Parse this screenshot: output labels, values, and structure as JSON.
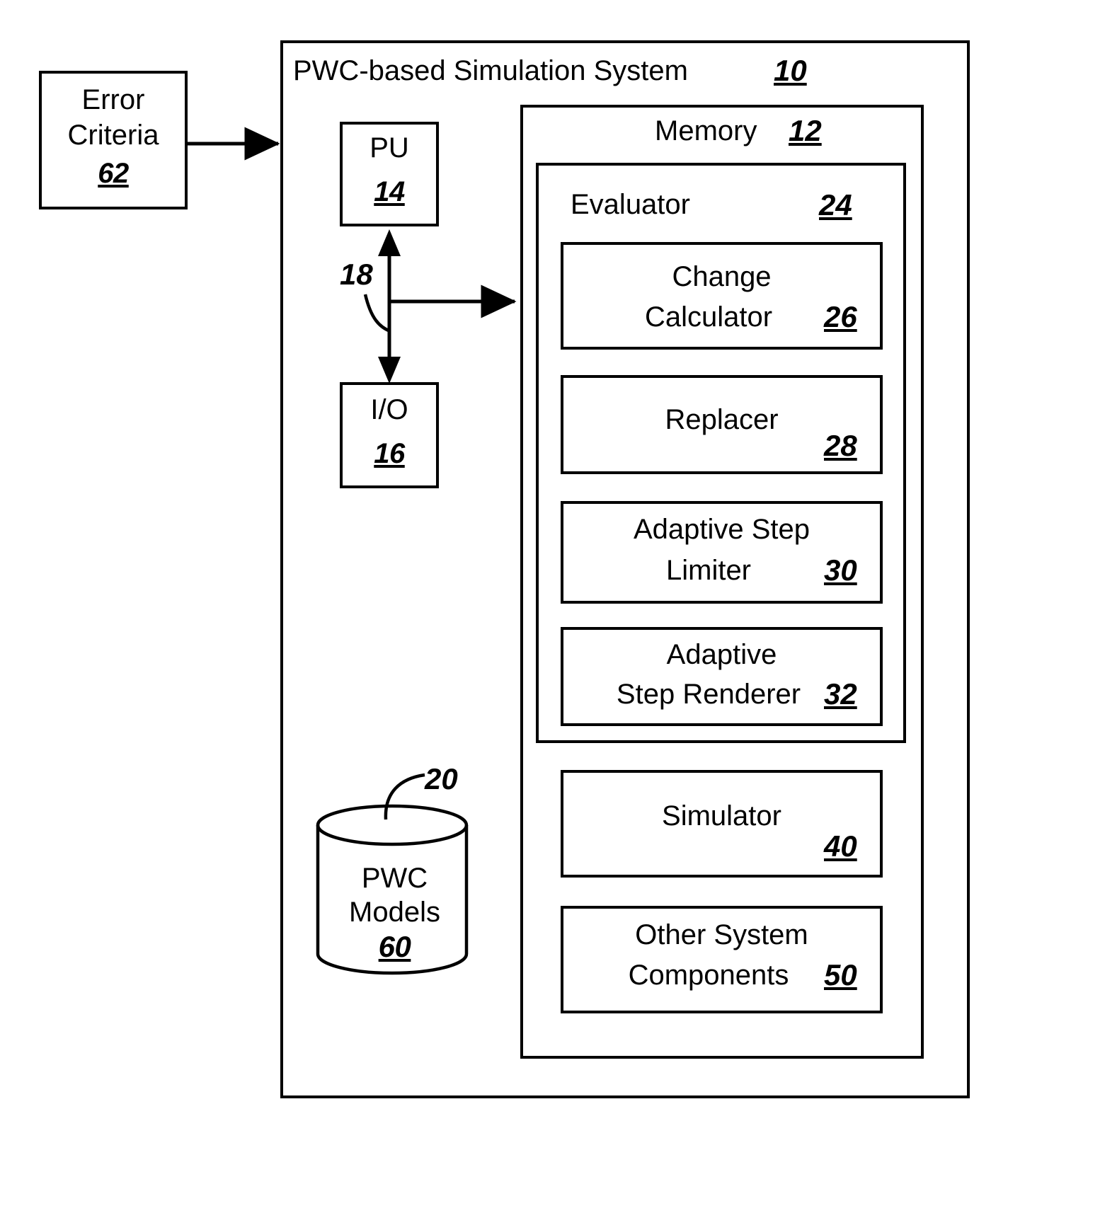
{
  "figure": {
    "system_box": {
      "title": "PWC-based Simulation System",
      "ref": "10"
    },
    "error_criteria": {
      "line1": "Error",
      "line2": "Criteria",
      "ref": "62"
    },
    "pu": {
      "label": "PU",
      "ref": "14"
    },
    "io": {
      "label": "I/O",
      "ref": "16"
    },
    "bus": {
      "ref": "18"
    },
    "memory": {
      "title": "Memory",
      "ref": "12"
    },
    "evaluator": {
      "title": "Evaluator",
      "ref": "24"
    },
    "evaluator_items": [
      {
        "line1": "Change",
        "line2": "Calculator",
        "ref": "26"
      },
      {
        "line1": "Replacer",
        "line2": "",
        "ref": "28"
      },
      {
        "line1": "Adaptive Step",
        "line2": "Limiter",
        "ref": "30"
      },
      {
        "line1": "Adaptive",
        "line2": "Step Renderer",
        "ref": "32"
      }
    ],
    "memory_items": [
      {
        "line1": "Simulator",
        "line2": "",
        "ref": "40"
      },
      {
        "line1": "Other System",
        "line2": "Components",
        "ref": "50"
      }
    ],
    "datastore": {
      "line1": "PWC",
      "line2": "Models",
      "ref": "60",
      "leader_ref": "20"
    }
  }
}
